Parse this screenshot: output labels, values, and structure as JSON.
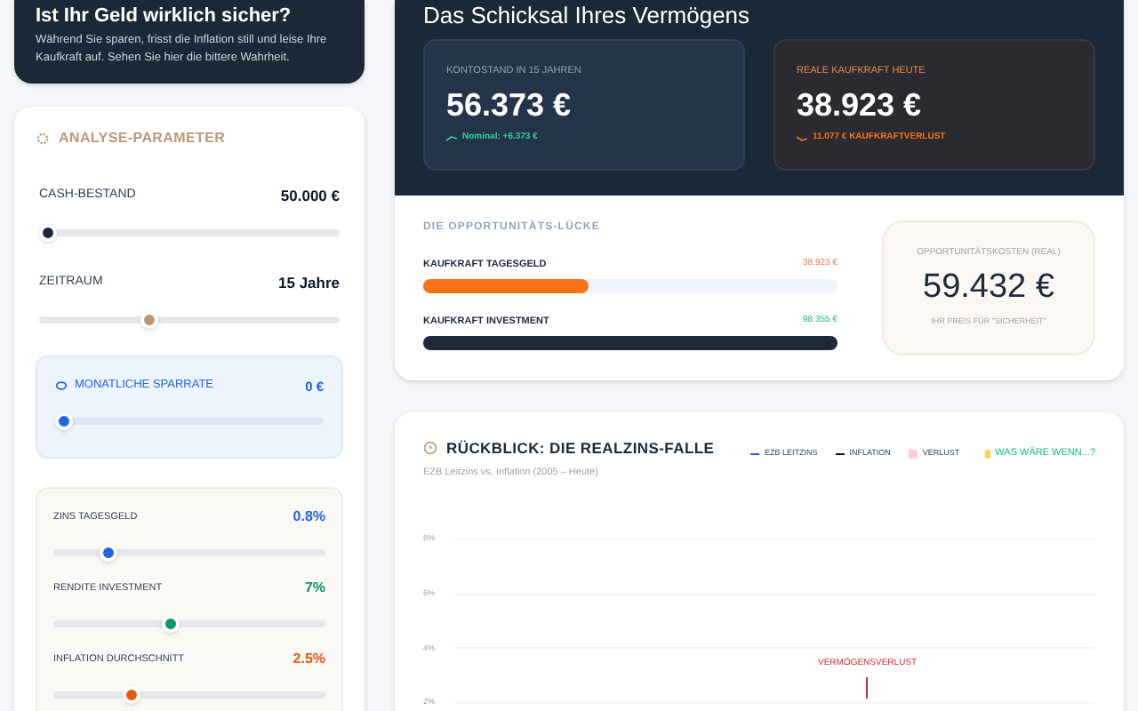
{
  "intro": {
    "title": "Ist Ihr Geld wirklich sicher?",
    "text": "Während Sie sparen, frisst die Inflation still und leise Ihre Kaufkraft auf. Sehen Sie hier die bittere Wahrheit."
  },
  "parameters": {
    "title": "ANALYSE-PARAMETER",
    "main": [
      {
        "label": "CASH-BESTAND",
        "value": "50.000 €",
        "level": 0.0,
        "color": "#1e293b"
      },
      {
        "label": "ZEITRAUM",
        "value": "15 Jahre",
        "level": 0.36,
        "color": "#b89a78"
      }
    ],
    "savings": {
      "label": "MONATLICHE SPARRATE",
      "value": "0 €",
      "level": 0
    },
    "rates": [
      {
        "label": "ZINS TAGESGELD",
        "value": "0.8%",
        "level": 0.18,
        "color": "#2563eb"
      },
      {
        "label": "RENDITE INVESTMENT",
        "value": "7%",
        "level": 0.43,
        "color": "#059669"
      },
      {
        "label": "INFLATION DURCHSCHNITT",
        "value": "2.5%",
        "level": 0.27,
        "color": "#ea580c"
      }
    ]
  },
  "fate": {
    "title": "Das Schicksal Ihres Vermögens",
    "cards": [
      {
        "kind": "nominal",
        "label": "KONTOSTAND IN 15 JAHREN",
        "value": "56.373 €",
        "note": "Nominal: +6.373 €"
      },
      {
        "kind": "real",
        "label": "REALE KAUFKRAFT HEUTE",
        "value": "38.923 €",
        "note": "11.077 € KAUFKRAFTVERLUST"
      }
    ]
  },
  "gap": {
    "title": "DIE OPPORTUNITÄTS-LÜCKE",
    "bars": [
      {
        "label": "KAUFKRAFT TAGESGELD",
        "value": "38.923 €",
        "level": 0.4,
        "color": "#f97316"
      },
      {
        "label": "KAUFKRAFT INVESTMENT",
        "value": "98.355 €",
        "level": 1.0,
        "color": "#1e293b"
      }
    ],
    "cost": {
      "label": "OPPORTUNITÄTSKOSTEN (REAL)",
      "value": "59.432 €",
      "note": "IHR PREIS FÜR \"SICHERHEIT\""
    }
  },
  "review": {
    "title": "RÜCKBLICK: DIE REALZINS-FALLE",
    "subtitle": "EZB Leitzins vs. Inflation (2005 – Heute)",
    "legend": [
      {
        "kind": "line",
        "label": "EZB LEITZINS",
        "color": "#2563eb"
      },
      {
        "kind": "line",
        "label": "INFLATION",
        "color": "#0f172a"
      },
      {
        "kind": "area",
        "label": "VERLUST",
        "color": "#fecdd3"
      },
      {
        "kind": "toggle",
        "label": "WAS WÄRE WENN...?",
        "color": "#10b981"
      }
    ],
    "y_ticks": [
      "8%",
      "6%",
      "4%",
      "2%"
    ],
    "annotation": "VERMÖGENSVERLUST"
  }
}
